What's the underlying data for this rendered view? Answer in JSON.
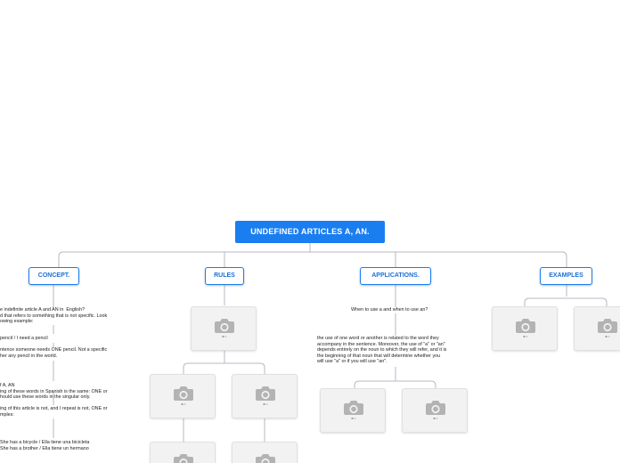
{
  "root": {
    "label": "UNDEFINED ARTICLES A, AN."
  },
  "branches": {
    "concept": "CONCEPT.",
    "rules": "RULES",
    "applications": "APPLICATIONS.",
    "examples": "EXAMPLES"
  },
  "concept": {
    "intro": "e indefinite article A and AN in  English?\nd that refers to something that is not specific. Look\nowing example:",
    "example": "pencil / I need a pencil",
    "explanation": "ntence someone needs ONE pencil. Not a specific\nher any pencil in the world.",
    "meaning": "f A, AN\ning of these words in Spanish is the same: ONE or\nhould use these words in the singular only.",
    "meaning2": "ing of this article is not, and I repeat is not, ONE or\nmples:",
    "sentences": "She has a bicycle / Ella tiene una bicicleta\nShe has a brother / Ella tiene un hermano"
  },
  "applications": {
    "question": "When to use a and when to use an?",
    "answer": "the use of one word or another is related to the word they\naccompany in the sentence. Moreover, the use of \"a\" or \"an\"\ndepends entirely on the noun to which they will refer, and it is\nthe beginning of that noun that will determine whether you\nwill use \"a\" or if you will use \"an\"."
  },
  "icons": {
    "placeholder": "camera-icon"
  },
  "colors": {
    "accent": "#1a7ef0",
    "connector": "#b4b9c3",
    "placeholder_bg": "#f2f2f2",
    "icon": "#b3b3b3"
  }
}
